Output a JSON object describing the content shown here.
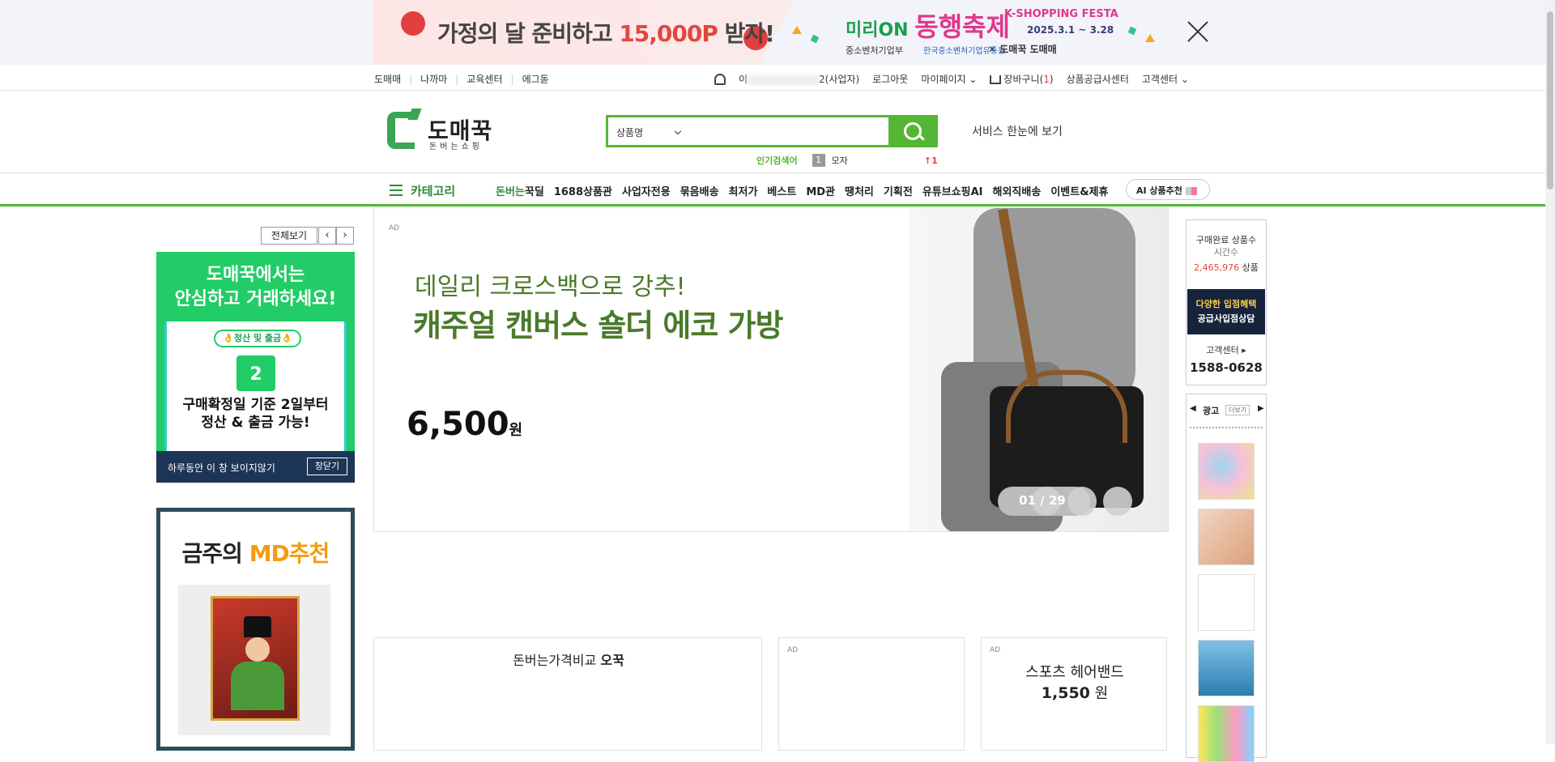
{
  "banner": {
    "headline_pre": "가정의 달 준비하고 ",
    "headline_highlight": "15,000P",
    "headline_post": " 받자!",
    "festa_brand": "미리ON",
    "festa_title": "동행축제",
    "festa_year": "2025",
    "festa_name": "K-SHOPPING FESTA",
    "festa_dates": "2025.3.1 ~ 3.28",
    "gov1": "중소벤처기업부",
    "gov2": "한국중소벤처기업유통원",
    "partners": "✕  도매꾹  도매매"
  },
  "util_left": [
    "도매매",
    "나까마",
    "교육센터",
    "에그돋"
  ],
  "util_right": {
    "user_prefix": "이",
    "user_suffix": "2(사업자)",
    "logout": "로그아웃",
    "mypage": "마이페이지",
    "cart_label": "장바구니(",
    "cart_count": "1",
    "cart_close": ")",
    "supply": "상품공급사센터",
    "cs": "고객센터"
  },
  "header": {
    "logo": "도매꾹",
    "logo_sub": "돈버는쇼핑",
    "search_select": "상품명",
    "search_value": "",
    "service_link": "서비스 한눈에 보기",
    "popular_label": "인기검색어",
    "popular_rank": "1",
    "popular_keyword": "모자",
    "popular_change": "↑1"
  },
  "nav": {
    "category": "카테고리",
    "first_green": "돈버는",
    "first_rest": "꾹딜",
    "items": [
      "1688상품관",
      "사업자전용",
      "묶음배송",
      "최저가",
      "베스트",
      "MD관",
      "땡처리",
      "기획전",
      "유튜브쇼핑AI",
      "해외직배송",
      "이벤트&제휴"
    ],
    "ai_label": "AI 상품추천"
  },
  "left": {
    "view_all": "전체보기",
    "prev": "‹",
    "next": "›",
    "ad_title_1": "도매꾹에서는",
    "ad_title_2": "안심하고 거래하세요!",
    "pill": "👌정산 및 출금👌",
    "calendar_num": "2",
    "ad_text_1": "구매확정일 기준 2일부터",
    "ad_text_2": "정산 & 출금 가능!",
    "hide_today": "하루동안 이 창 보이지않기",
    "close_window": "창닫기",
    "md_pre": "금주의 ",
    "md_highlight": "MD추천"
  },
  "main_banner": {
    "ad": "AD",
    "subtitle": "데일리 크로스백으로 강추!",
    "title": "캐주얼 캔버스 숄더 에코 가방",
    "price": "6,500",
    "won": "원",
    "pager": "01 / 29"
  },
  "cards": {
    "c1_pre": "돈버는가격비교 ",
    "c1_bold": "오꾹",
    "c2_ad": "AD",
    "c3_ad": "AD",
    "c3_name": "스포츠 헤어밴드",
    "c3_price": "1,550",
    "c3_won": " 원"
  },
  "right": {
    "completed_label": "구매완료 상품수",
    "sub_label": "시간수",
    "count": "2,465,976",
    "count_suffix": " 상품",
    "promo_1": "다양한 입점혜택",
    "promo_2": "공급사입점상담",
    "cs_label": "고객센터 ▸",
    "phone": "1588-0628",
    "ad_title": "광고",
    "ad_more": "더보기",
    "ad_prev": "◀",
    "ad_next": "▶"
  }
}
